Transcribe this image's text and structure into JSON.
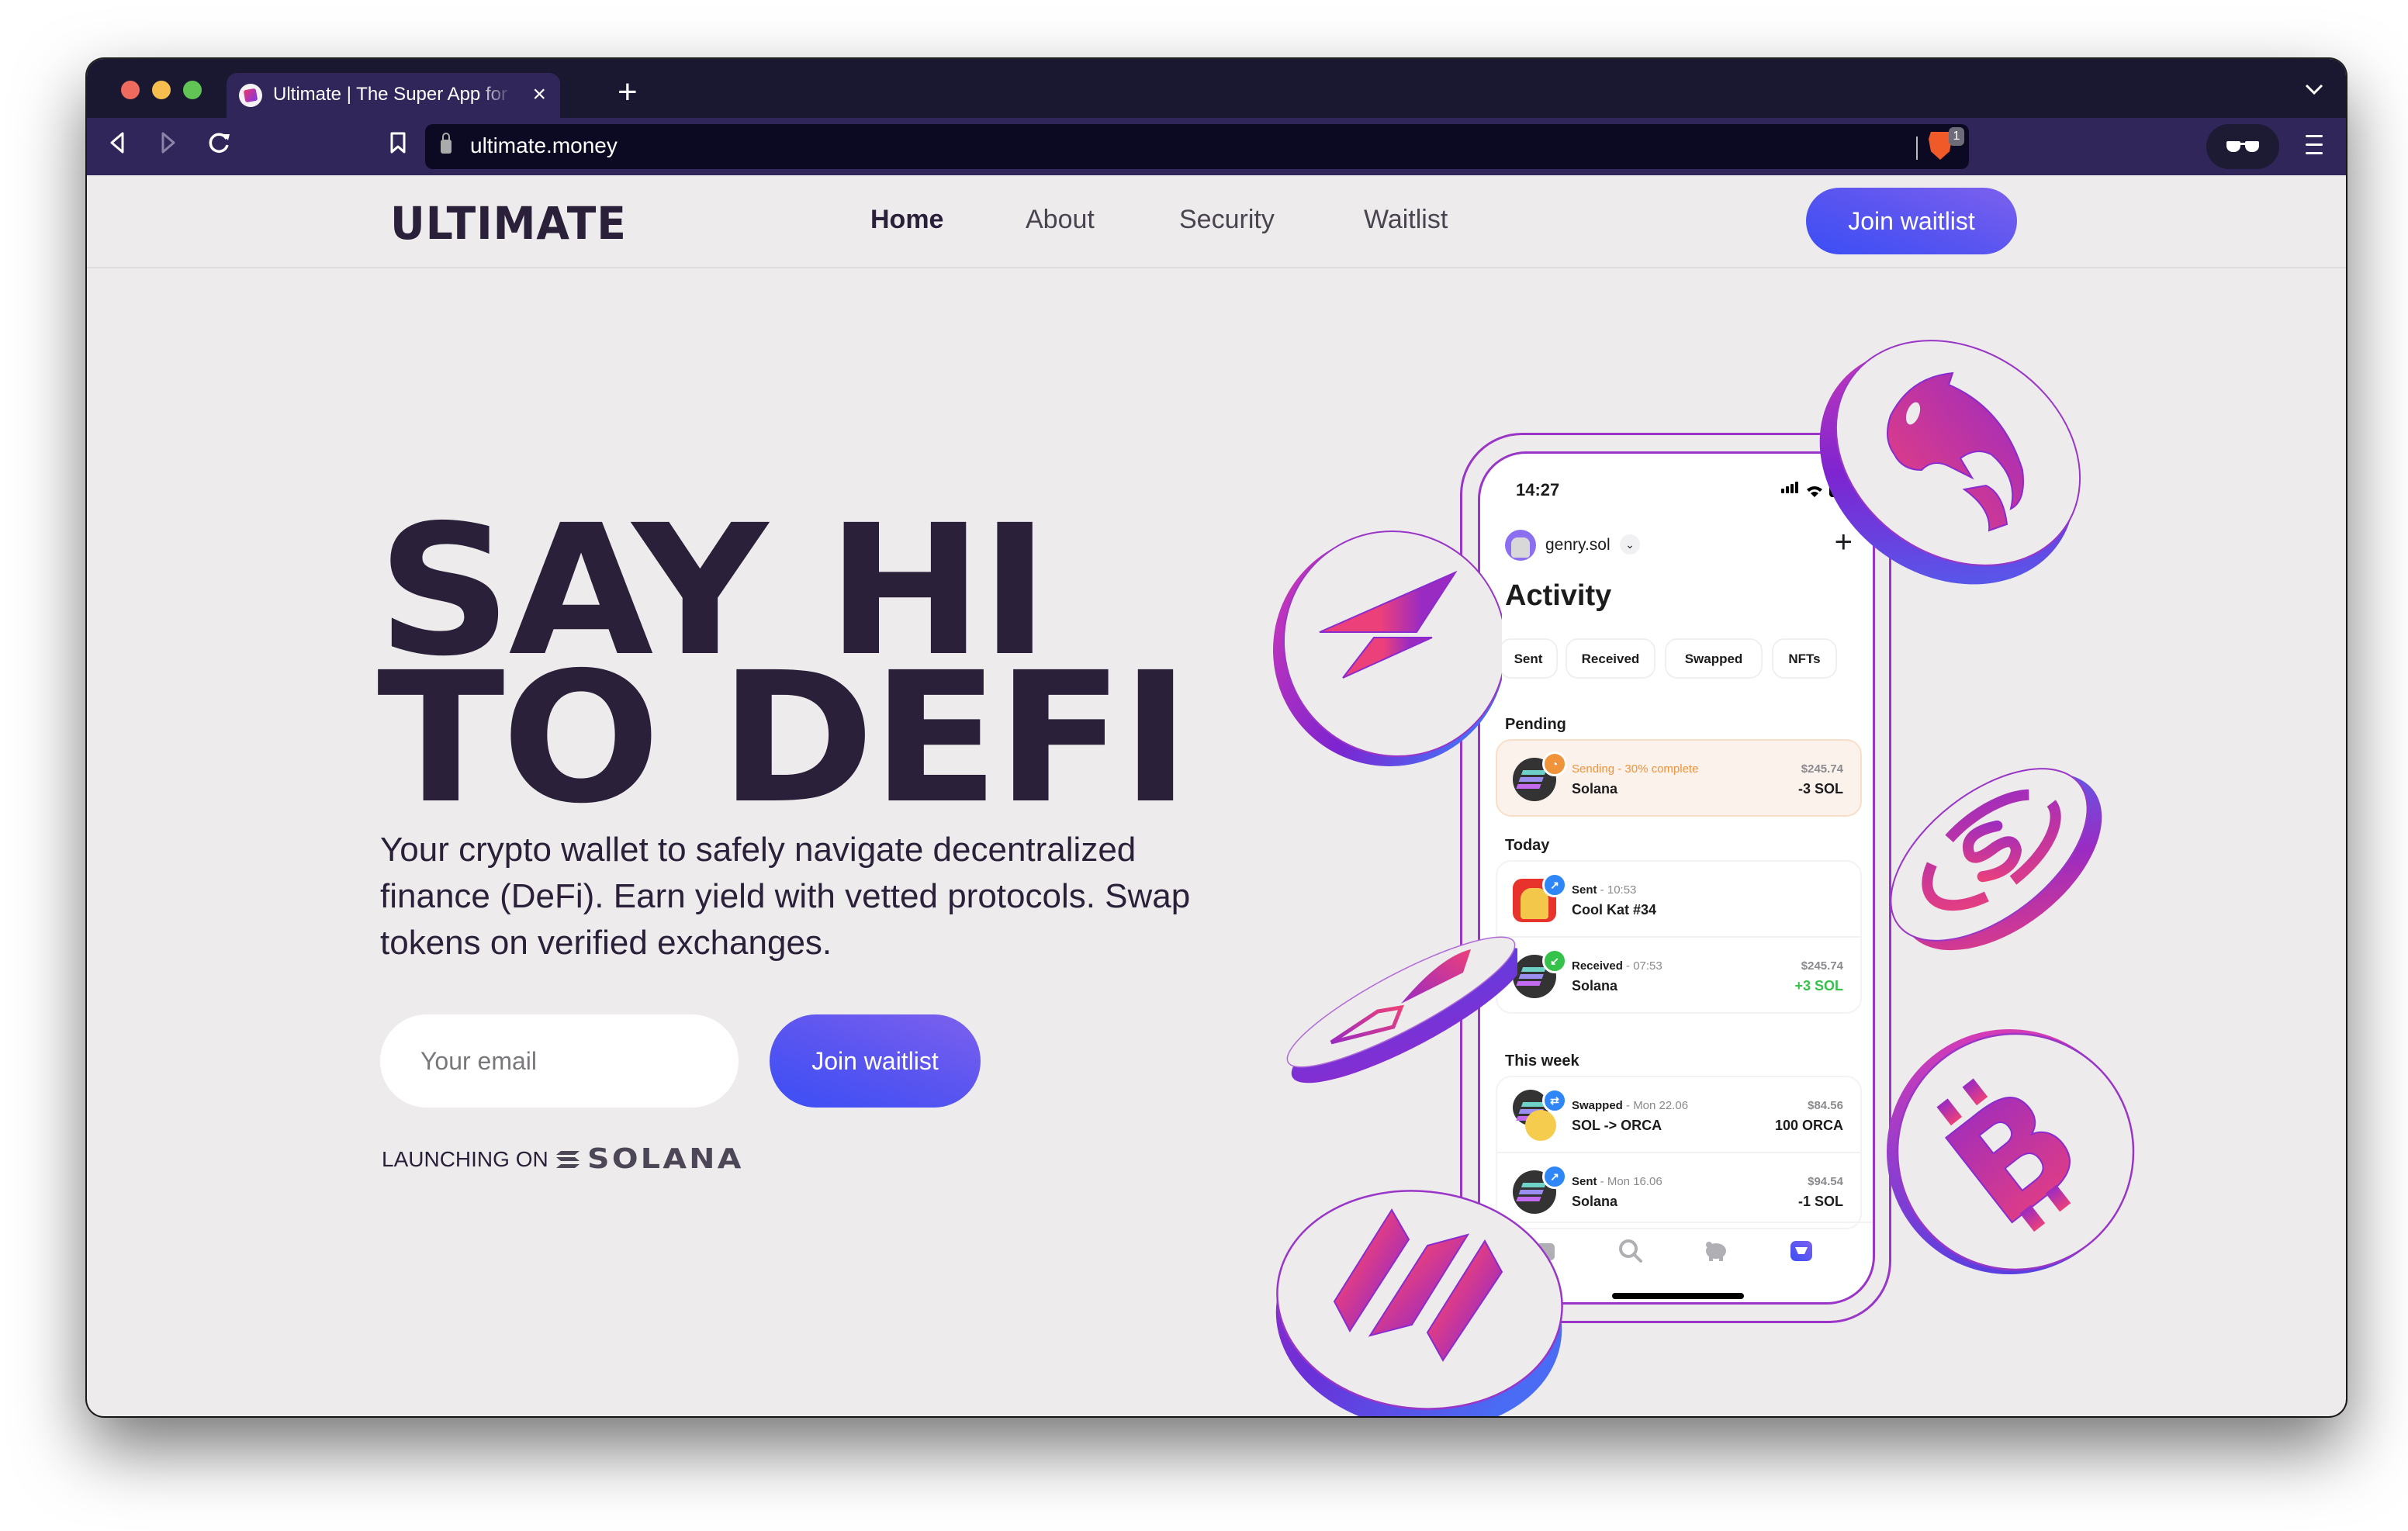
{
  "browser": {
    "tab_title": "Ultimate | The Super App for all",
    "tab_close": "×",
    "new_tab": "+",
    "url": "ultimate.money",
    "shields_count": "1",
    "back": "◁",
    "forward": "▷",
    "reload": "↻",
    "tab_list_chevron": "⌄"
  },
  "header": {
    "logo": "ULTIMATE",
    "nav": [
      {
        "label": "Home",
        "active": true
      },
      {
        "label": "About",
        "active": false
      },
      {
        "label": "Security",
        "active": false
      },
      {
        "label": "Waitlist",
        "active": false
      }
    ],
    "cta_label": "Join waitlist"
  },
  "hero": {
    "headline_line1": "SAY HI",
    "headline_line2": "TO DEFI",
    "subtitle": "Your crypto wallet to safely navigate decentralized finance (DeFi). Earn yield with vetted protocols. Swap tokens on verified exchanges.",
    "email_placeholder": "Your email",
    "email_value": "",
    "cta_label": "Join waitlist",
    "launching_label": "LAUNCHING ON",
    "chain_name": "SOLANA"
  },
  "colors": {
    "text_primary": "#2a2039",
    "page_bg": "#edebec",
    "cta_gradient_start": "#3b4ef5",
    "cta_gradient_end": "#7d61ee",
    "coin_pink": "#ec407a",
    "coin_purple": "#8a2bd0",
    "coin_blue": "#4a6cf5",
    "pending_orange": "#f0933a",
    "received_green": "#35c24a",
    "sent_blue": "#2f86f6"
  },
  "phone": {
    "status_time": "14:27",
    "account_name": "genry.sol",
    "add_label": "+",
    "screen_title": "Activity",
    "filters": [
      "Sent",
      "Received",
      "Swapped",
      "NFTs"
    ],
    "sections": [
      {
        "title": "Pending",
        "items": [
          {
            "type": "pending",
            "icon": "solana-token-icon",
            "badge": "clock-icon",
            "status": "Sending - 30% complete",
            "progress_percent": 30,
            "meta": "",
            "name": "Solana",
            "usd": "$245.74",
            "amount": "-3 SOL"
          }
        ]
      },
      {
        "title": "Today",
        "items": [
          {
            "type": "sent",
            "icon": "nft-cat-icon",
            "badge": "arrow-up-right-icon",
            "status": "Sent",
            "meta": " - 10:53",
            "name": "Cool Kat #34",
            "usd": "",
            "amount": ""
          },
          {
            "type": "received",
            "icon": "solana-token-icon",
            "badge": "arrow-down-left-icon",
            "status": "Received",
            "meta": " - 07:53",
            "name": "Solana",
            "usd": "$245.74",
            "amount": "+3 SOL"
          }
        ]
      },
      {
        "title": "This week",
        "items": [
          {
            "type": "swapped",
            "icon": "solana-orca-swap-icon",
            "badge": "swap-icon",
            "status": "Swapped",
            "meta": " - Mon 22.06",
            "name": "SOL -> ORCA",
            "usd": "$84.56",
            "amount": "100 ORCA"
          },
          {
            "type": "sent",
            "icon": "solana-token-icon",
            "badge": "arrow-up-right-icon",
            "status": "Sent",
            "meta": " - Mon 16.06",
            "name": "Solana",
            "usd": "$94.54",
            "amount": "-1 SOL"
          }
        ]
      }
    ],
    "tabbar": [
      "home-icon",
      "search-icon",
      "piggy-bank-icon",
      "inbox-icon"
    ],
    "active_tab": "inbox-icon"
  },
  "coins": [
    "lightning-coin",
    "orca-coin",
    "usdc-coin",
    "arrow-coin",
    "bitcoin-coin",
    "solana-stripes-coin"
  ]
}
